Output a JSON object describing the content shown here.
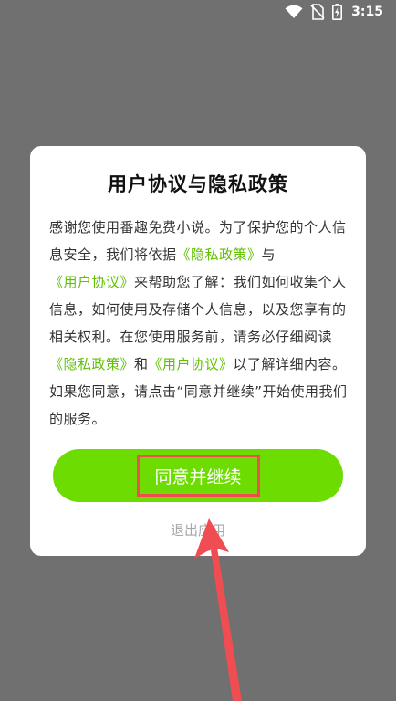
{
  "status_bar": {
    "time": "3:15",
    "icons": [
      "wifi-icon",
      "no-sim-icon",
      "battery-charging-icon"
    ]
  },
  "dialog": {
    "title": "用户协议与隐私政策",
    "body": {
      "t1": "感谢您使用番趣免费小说。为了保护您的个人信息安全，我们将依据",
      "link_privacy": "《隐私政策》",
      "t2": "与",
      "link_user": "《用户协议》",
      "t3": "来帮助您了解：我们如何收集个人信息，如何使用及存储个人信息，以及您享有的相关权利。在您使用服务前，请务必仔细阅读",
      "link_privacy_2": "《隐私政策》",
      "t4": "和",
      "link_user_2": "《用户协议》",
      "t5": "以了解详细内容。如果您同意，请点击“同意并继续”开始使用我们的服务。"
    },
    "agree_label": "同意并继续",
    "exit_label": "退出应用"
  },
  "colors": {
    "accent_green": "#6ddc00",
    "link_green": "#5fc200",
    "highlight_red": "#ef4d52",
    "overlay": "#6f706f"
  }
}
